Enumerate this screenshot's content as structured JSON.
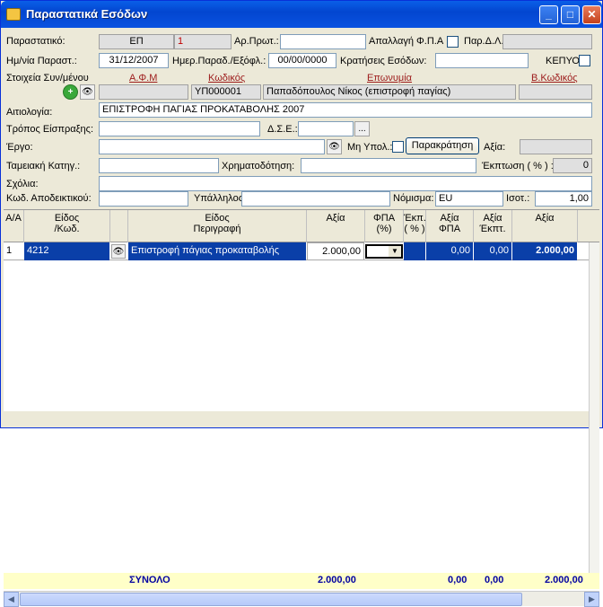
{
  "window": {
    "title": "Παραστατικά Εσόδων",
    "min": "_",
    "max": "□",
    "close": "✕"
  },
  "form": {
    "doc_label": "Παραστατικό:",
    "doc_code": "ΕΠ",
    "doc_num": "1",
    "arprot_label": "Αρ.Πρωτ.:",
    "arprot_value": "",
    "vat_exempt_label": "Απαλλαγή Φ.Π.Α",
    "pard_label": "Παρ.Δ.Λ.",
    "pard_value": "",
    "date_label": "Ημ/νία Παραστ.:",
    "date_value": "31/12/2007",
    "deliv_label": "Ημερ.Παραδ./Εξόφλ.:",
    "deliv_value": "00/00/0000",
    "holds_label": "Κρατήσεις Εσόδων:",
    "holds_value": "",
    "kepyo_label": "ΚΕΠΥΟ:",
    "party_label": "Στοιχεία Συν/μένου",
    "afm_label": "Α.Φ.Μ",
    "code_label": "Κωδικός",
    "name_label": "Επωνυμία",
    "bcode_label": "Β.Κωδικός",
    "afm_value": "",
    "code_value": "ΥΠ000001",
    "name_value": "Παπαδόπουλος Νίκος (επιστροφή παγίας)",
    "bcode_value": "",
    "reason_label": "Αιτιολογία:",
    "reason_value": "ΕΠΙΣΤΡΟΦΗ ΠΑΓΙΑΣ ΠΡΟΚΑΤΑΒΟΛΗΣ 2007",
    "payway_label": "Τρόπος Είσπραξης:",
    "payway_value": "",
    "dse_label": "Δ.Σ.Ε.:",
    "dse_value": "",
    "dse_btn": "...",
    "project_label": "Έργο:",
    "project_value": "",
    "nonupd_label": "Μη Υπολ.:",
    "withhold_btn": "Παρακράτηση",
    "value_label": "Αξία:",
    "value_value": "",
    "cash_label": "Ταμειακή Κατηγ.:",
    "cash_value": "",
    "finance_label": "Χρηματοδότηση:",
    "finance_value": "",
    "disc_label": "Έκπτωση ( % ) :",
    "disc_value": "0",
    "comments_label": "Σχόλια:",
    "comments_value": "",
    "receipt_label": "Κωδ. Αποδεικτικού:",
    "receipt_value": "",
    "employee_label": "Υπάλληλος:",
    "employee_value": "",
    "currency_label": "Νόμισμα:",
    "currency_value": "EU",
    "rate_label": "Ισοτ.:",
    "rate_value": "1,00"
  },
  "grid": {
    "headers": {
      "aa": "Α/Α",
      "item1": "Είδος",
      "item2": "/Κωδ.",
      "desc1": "Είδος",
      "desc2": "Περιγραφή",
      "value": "Αξία",
      "fpa": "ΦΠΑ (%)",
      "disc1": "Έκπ.",
      "disc2": "( % )",
      "vfpa1": "Αξία",
      "vfpa2": "ΦΠΑ",
      "vdisc1": "Αξία",
      "vdisc2": "Έκπτ.",
      "total": "Αξία"
    },
    "rows": [
      {
        "aa": "1",
        "code": "4212",
        "desc": "Επιστροφή πάγιας προκαταβολής",
        "value": "2.000,00",
        "fpa": "",
        "disc": "",
        "vfpa": "0,00",
        "vdisc": "0,00",
        "total": "2.000,00"
      }
    ],
    "footer": {
      "label": "ΣΥΝΟΛΟ",
      "value": "2.000,00",
      "vfpa": "0,00",
      "vdisc": "0,00",
      "total": "2.000,00"
    }
  }
}
